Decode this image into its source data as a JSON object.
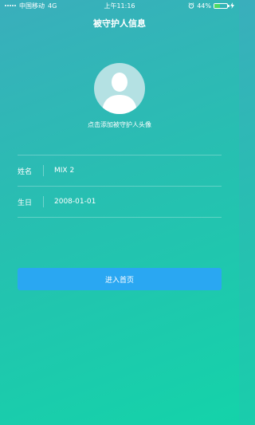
{
  "status_bar": {
    "carrier": "中国移动",
    "network": "4G",
    "time": "上午11:16",
    "battery_percent": "44%",
    "battery_level": 0.44,
    "battery_color": "#4cd964"
  },
  "header": {
    "title": "被守护人信息"
  },
  "avatar": {
    "caption": "点击添加被守护人头像",
    "icon": "user-silhouette-icon"
  },
  "form": {
    "fields": [
      {
        "label": "姓名",
        "value": "MIX 2"
      },
      {
        "label": "生日",
        "value": "2008-01-01"
      }
    ]
  },
  "actions": {
    "enter_label": "进入首页",
    "enter_color": "#2aa7f2"
  }
}
